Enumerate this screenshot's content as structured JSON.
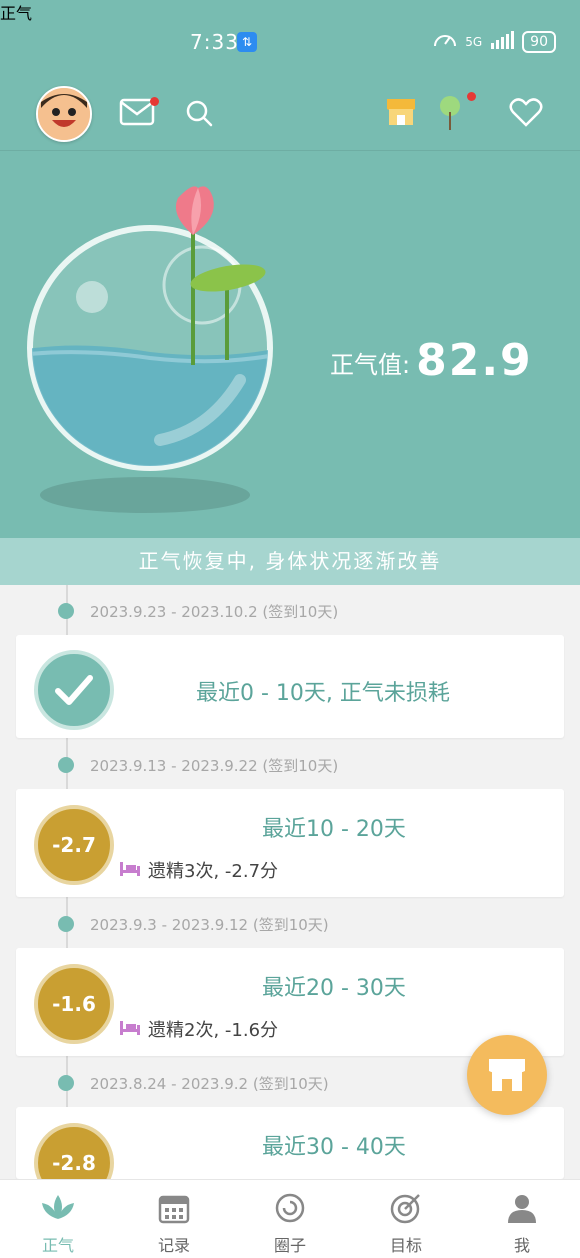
{
  "status": {
    "time": "7:33",
    "network": "5G",
    "battery": "90"
  },
  "header": {
    "title": "正气"
  },
  "hero": {
    "label": "正气值:",
    "value": "82.9"
  },
  "banner": {
    "text": "正气恢复中, 身体状况逐渐改善"
  },
  "timeline": [
    {
      "date": "2023.9.23 - 2023.10.2 (签到10天)",
      "title": "最近0 - 10天, 正气未损耗",
      "badge": "✓",
      "detail": ""
    },
    {
      "date": "2023.9.13 - 2023.9.22 (签到10天)",
      "title": "最近10 - 20天",
      "badge": "-2.7",
      "detail": "遗精3次, -2.7分"
    },
    {
      "date": "2023.9.3 - 2023.9.12 (签到10天)",
      "title": "最近20 - 30天",
      "badge": "-1.6",
      "detail": "遗精2次, -1.6分"
    },
    {
      "date": "2023.8.24 - 2023.9.2 (签到10天)",
      "title": "最近30 - 40天",
      "badge": "-2.8",
      "detail": ""
    }
  ],
  "tabs": [
    {
      "label": "正气"
    },
    {
      "label": "记录"
    },
    {
      "label": "圈子"
    },
    {
      "label": "目标"
    },
    {
      "label": "我"
    }
  ],
  "colors": {
    "primary": "#78bcb1",
    "gold": "#c99f32",
    "fab": "#f4bb5d"
  }
}
